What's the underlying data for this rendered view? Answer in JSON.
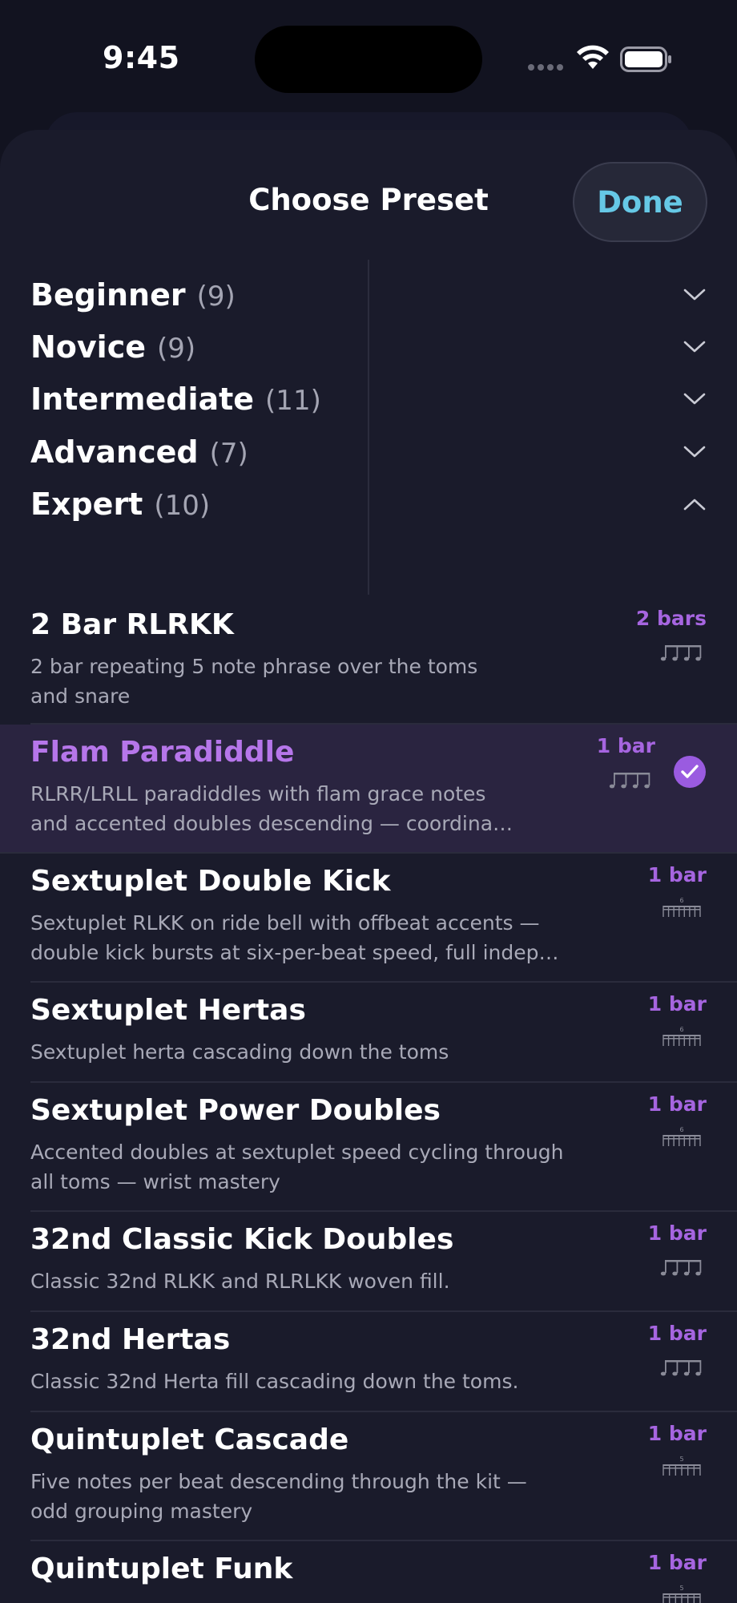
{
  "status": {
    "time": "9:45"
  },
  "sheet": {
    "title": "Choose Preset",
    "done_label": "Done"
  },
  "categories": [
    {
      "name": "Beginner",
      "count": "(9)",
      "expanded": false
    },
    {
      "name": "Novice",
      "count": "(9)",
      "expanded": false
    },
    {
      "name": "Intermediate",
      "count": "(11)",
      "expanded": false
    },
    {
      "name": "Advanced",
      "count": "(7)",
      "expanded": false
    },
    {
      "name": "Expert",
      "count": "(10)",
      "expanded": true
    }
  ],
  "presets": [
    {
      "title": "2 Bar RLRKK",
      "desc1": "2 bar repeating 5 note phrase over the toms",
      "desc2": "and snare",
      "bars": "2 bars",
      "selected": false,
      "tuplet": ""
    },
    {
      "title": "Flam Paradiddle",
      "desc1": "RLRR/LRLL paradiddles with flam grace notes",
      "desc2": "and accented doubles descending — coordina…",
      "bars": "1 bar",
      "selected": true,
      "tuplet": ""
    },
    {
      "title": "Sextuplet Double Kick",
      "desc1": "Sextuplet RLKK on ride bell with offbeat accents —",
      "desc2": "double kick bursts at six-per-beat speed, full indep…",
      "bars": "1 bar",
      "selected": false,
      "tuplet": "6"
    },
    {
      "title": "Sextuplet Hertas",
      "desc1": "Sextuplet herta cascading down the toms",
      "desc2": "",
      "bars": "1 bar",
      "selected": false,
      "tuplet": "6"
    },
    {
      "title": "Sextuplet Power Doubles",
      "desc1": "Accented doubles at sextuplet speed cycling through",
      "desc2": "all toms — wrist mastery",
      "bars": "1 bar",
      "selected": false,
      "tuplet": "6"
    },
    {
      "title": "32nd Classic Kick Doubles",
      "desc1": "Classic 32nd RLKK and RLRLKK woven fill.",
      "desc2": "",
      "bars": "1 bar",
      "selected": false,
      "tuplet": ""
    },
    {
      "title": "32nd Hertas",
      "desc1": "Classic 32nd Herta fill cascading down the toms.",
      "desc2": "",
      "bars": "1 bar",
      "selected": false,
      "tuplet": ""
    },
    {
      "title": "Quintuplet Cascade",
      "desc1": "Five notes per beat descending through the kit —",
      "desc2": "odd grouping mastery",
      "bars": "1 bar",
      "selected": false,
      "tuplet": "5"
    },
    {
      "title": "Quintuplet Funk",
      "desc1": "",
      "desc2": "",
      "bars": "1 bar",
      "selected": false,
      "tuplet": "5"
    }
  ],
  "colors": {
    "accent_purple": "#a665e0",
    "done_blue": "#66c8e6",
    "background": "#1a1b2b"
  }
}
